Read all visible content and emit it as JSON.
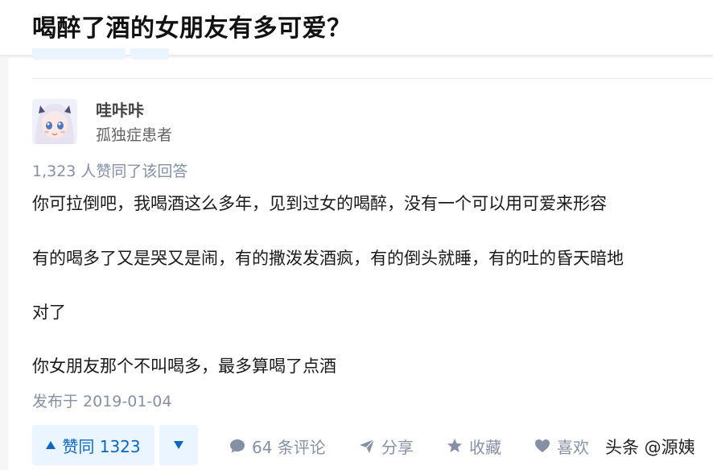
{
  "question": {
    "title": "喝醉了酒的女朋友有多可爱？"
  },
  "author": {
    "name": "哇咔咔",
    "bio": "孤独症患者"
  },
  "answer": {
    "vote_summary": "1,323 人赞同了该回答",
    "paragraphs": [
      "你可拉倒吧，我喝酒这么多年，见到过女的喝醉，没有一个可以用可爱来形容",
      "有的喝多了又是哭又是闹，有的撒泼发酒疯，有的倒头就睡，有的吐的昏天暗地",
      "对了",
      "你女朋友那个不叫喝多，最多算喝了点酒"
    ],
    "publish_time": "发布于 2019-01-04"
  },
  "actions": {
    "vote_up_label": "赞同 1323",
    "comments_label": "64 条评论",
    "share_label": "分享",
    "collect_label": "收藏",
    "like_label": "喜欢"
  },
  "watermark": "头条 @源姨",
  "icons": {
    "vote_up": "triangle-up-icon",
    "vote_down": "triangle-down-icon",
    "comment": "speech-bubble-icon",
    "share": "paper-plane-icon",
    "collect": "star-icon",
    "like": "heart-icon"
  },
  "colors": {
    "accent": "#0a66c2",
    "vote_bg": "#ebf5ff",
    "meta_text": "#8590a6",
    "page_bg": "#f6f6f6"
  }
}
